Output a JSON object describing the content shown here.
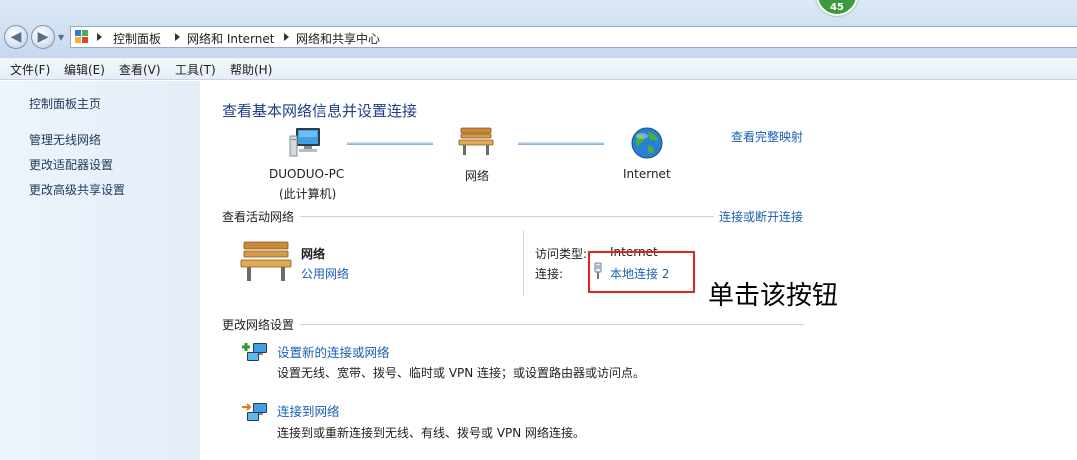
{
  "badge": {
    "count": "45"
  },
  "breadcrumb": {
    "items": [
      "控制面板",
      "网络和 Internet",
      "网络和共享中心"
    ]
  },
  "menu": {
    "items": [
      "文件(F)",
      "编辑(E)",
      "查看(V)",
      "工具(T)",
      "帮助(H)"
    ]
  },
  "sidebar": {
    "home": "控制面板主页",
    "links": [
      "管理无线网络",
      "更改适配器设置",
      "更改高级共享设置"
    ]
  },
  "main": {
    "title": "查看基本网络信息并设置连接",
    "view_full_map": "查看完整映射",
    "map": {
      "computer_name": "DUODUO-PC",
      "computer_sub": "(此计算机)",
      "network": "网络",
      "internet": "Internet"
    },
    "active": {
      "heading": "查看活动网络",
      "connect_disconnect": "连接或断开连接",
      "network_name": "网络",
      "network_type": "公用网络",
      "access_type_label": "访问类型:",
      "access_type_value": "Internet",
      "connection_label": "连接:",
      "connection_value": "本地连接 2"
    },
    "change": {
      "heading": "更改网络设置",
      "tasks": [
        {
          "title": "设置新的连接或网络",
          "desc": "设置无线、宽带、拨号、临时或 VPN 连接；或设置路由器或访问点。"
        },
        {
          "title": "连接到网络",
          "desc": "连接到或重新连接到无线、有线、拨号或 VPN 网络连接。"
        }
      ]
    }
  },
  "annotation": {
    "text": "单击该按钮"
  },
  "colors": {
    "link": "#1a5fb4",
    "title": "#1e3f8a",
    "highlight": "#e02424",
    "badge": "#3c9a3c"
  }
}
